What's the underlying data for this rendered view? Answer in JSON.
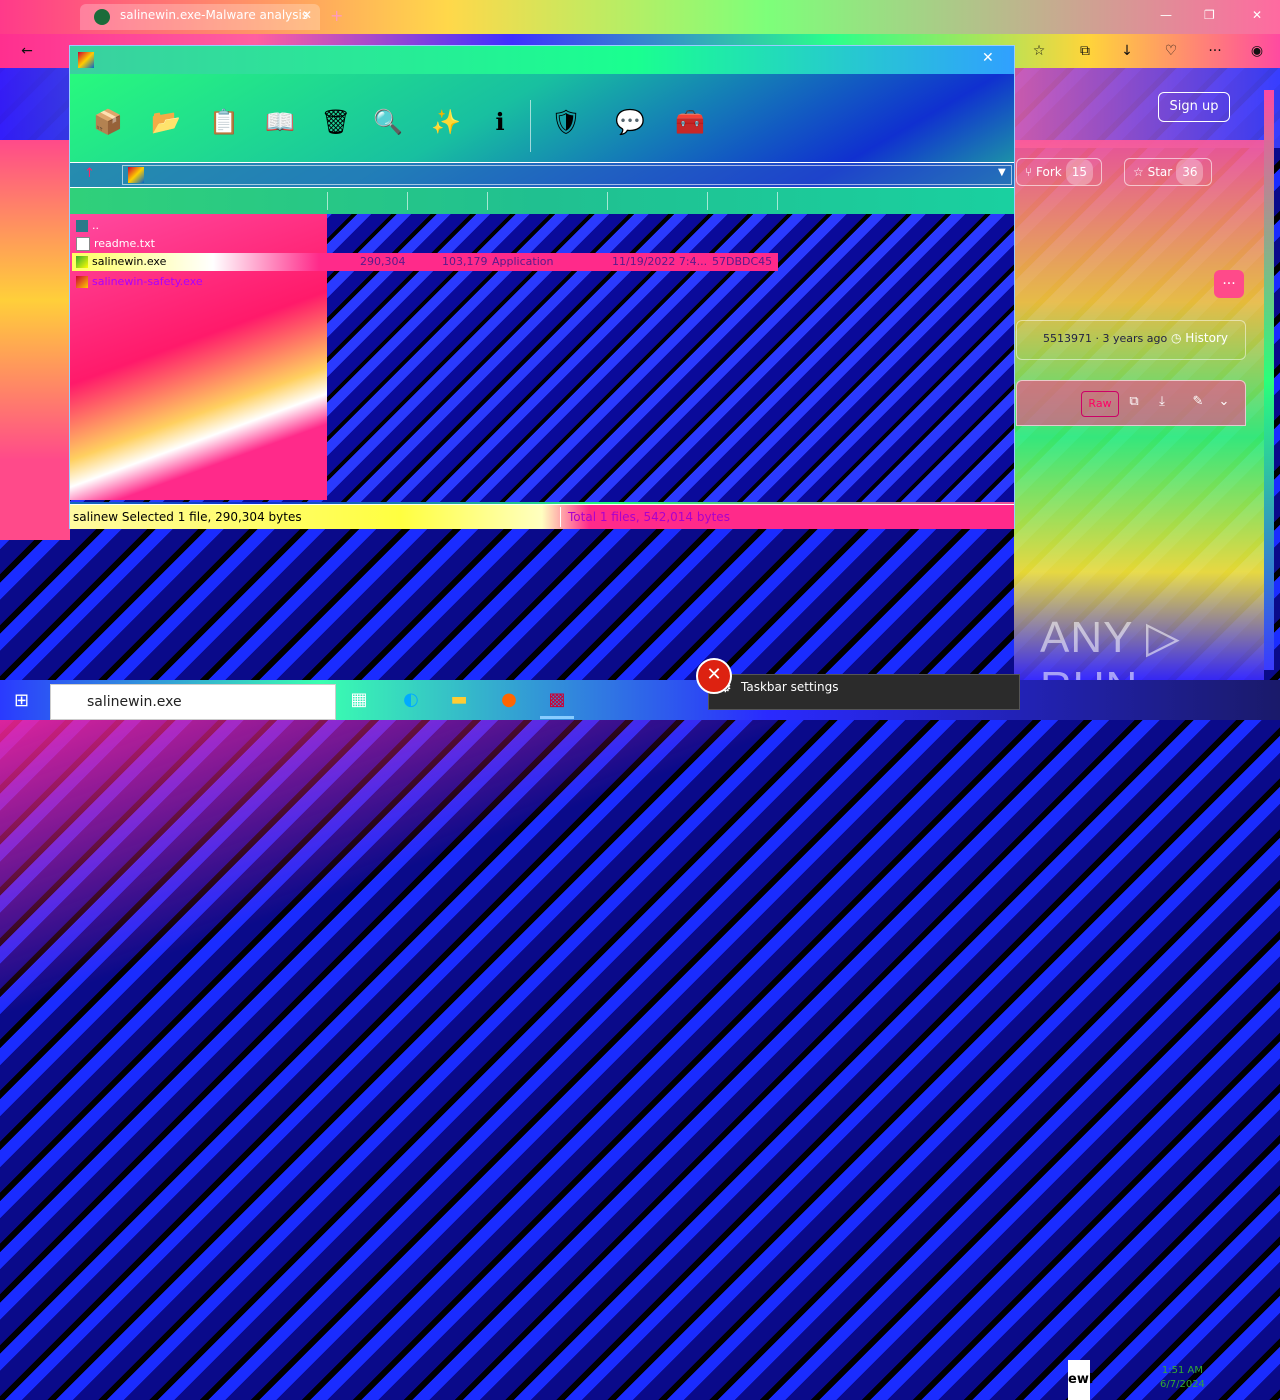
{
  "browser": {
    "tab_title": "salinewin.exe-Malware analysis",
    "new_tab": "+",
    "win_controls": [
      "—",
      "❐",
      "✕"
    ]
  },
  "github": {
    "signup": "Sign up",
    "fork_label": "Fork",
    "fork_count": "15",
    "star_label": "Star",
    "star_count": "36",
    "commit_hash": "5513971 · 3 years ago",
    "history": "History",
    "raw": "Raw",
    "more": "···"
  },
  "rar": {
    "toolbar": [
      {
        "name": "add",
        "glyph": "📦"
      },
      {
        "name": "extract-to",
        "glyph": "📂"
      },
      {
        "name": "test",
        "glyph": "📋"
      },
      {
        "name": "view",
        "glyph": "📖"
      },
      {
        "name": "delete",
        "glyph": "🗑"
      },
      {
        "name": "find",
        "glyph": "🔍"
      },
      {
        "name": "wizard",
        "glyph": "✨"
      },
      {
        "name": "info",
        "glyph": "ℹ"
      },
      {
        "name": "virus-scan",
        "glyph": "🛡"
      },
      {
        "name": "comment",
        "glyph": "💬"
      },
      {
        "name": "sfx",
        "glyph": "🧰"
      }
    ],
    "files": [
      {
        "name": "..",
        "size": "",
        "packed": "",
        "type": "",
        "modified": "",
        "crc": ""
      },
      {
        "name": "readme.txt",
        "size": "",
        "packed": "",
        "type": "",
        "modified": "",
        "crc": ""
      },
      {
        "name": "salinewin.exe",
        "size": "290,304",
        "packed": "103,179",
        "type": "Application",
        "modified": "11/19/2022 7:4...",
        "crc": "57DBDC45"
      },
      {
        "name": "salinewin-safety.exe",
        "size": "",
        "packed": "",
        "type": "",
        "modified": "",
        "crc": ""
      }
    ],
    "status_left": "salinew  Selected 1 file, 290,304 bytes",
    "status_right": "Total 1 files, 542,014 bytes"
  },
  "taskbar": {
    "search_text": "salinewin.exe",
    "popup_text": "Taskbar settings",
    "tray_text": "ewi",
    "clock_time": "1:51 AM",
    "clock_date": "6/7/2024"
  },
  "watermark": "ANY ▷ RUN"
}
